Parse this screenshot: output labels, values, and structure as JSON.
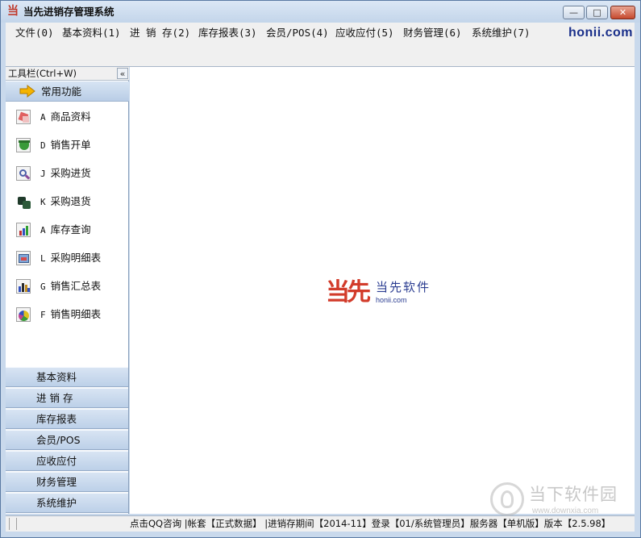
{
  "window": {
    "title": "当先进销存管理系统",
    "app_icon_glyph": "当",
    "minimize_label": "—",
    "maximize_label": "□",
    "close_label": "✕"
  },
  "menubar": {
    "items": [
      {
        "label": "文件(0)"
      },
      {
        "label": "基本资料(1)"
      },
      {
        "label": "进 销 存(2)"
      },
      {
        "label": "库存报表(3)"
      },
      {
        "label": "会员/POS(4)"
      },
      {
        "label": "应收应付(5)"
      },
      {
        "label": "财务管理(6)"
      },
      {
        "label": "系统维护(7)"
      }
    ],
    "brand": "honii.com"
  },
  "sidebar": {
    "toolbar_title": "工具栏(Ctrl+W)",
    "collapse_label": "«",
    "current_section": "常用功能",
    "functions": [
      {
        "key": "A",
        "label": "商品资料",
        "icon": "product-icon"
      },
      {
        "key": "D",
        "label": "销售开单",
        "icon": "sales-order-icon"
      },
      {
        "key": "J",
        "label": "采购进货",
        "icon": "purchase-icon"
      },
      {
        "key": "K",
        "label": "采购退货",
        "icon": "purchase-return-icon"
      },
      {
        "key": "A",
        "label": "库存查询",
        "icon": "inventory-query-icon"
      },
      {
        "key": "L",
        "label": "采购明细表",
        "icon": "purchase-detail-icon"
      },
      {
        "key": "G",
        "label": "销售汇总表",
        "icon": "sales-summary-icon"
      },
      {
        "key": "F",
        "label": "销售明细表",
        "icon": "sales-detail-icon"
      }
    ],
    "categories": [
      {
        "label": "基本资料"
      },
      {
        "label": "进 销 存"
      },
      {
        "label": "库存报表"
      },
      {
        "label": "会员/POS"
      },
      {
        "label": "应收应付"
      },
      {
        "label": "财务管理"
      },
      {
        "label": "系统维护"
      }
    ]
  },
  "main": {
    "logo_mark": "当先",
    "logo_name": "当先软件",
    "logo_url": "honii.com"
  },
  "statusbar": {
    "text": "点击QQ咨询 |帐套【正式数据】 |进销存期间【2014-11】登录【01/系统管理员】服务器【单机版】版本【2.5.98】"
  },
  "watermark": {
    "name": "当下软件园",
    "url": "www.downxia.com"
  },
  "colors": {
    "accent_red": "#d23b2a",
    "brand_blue": "#2b3d91",
    "panel_blue": "#bcd0e8"
  }
}
